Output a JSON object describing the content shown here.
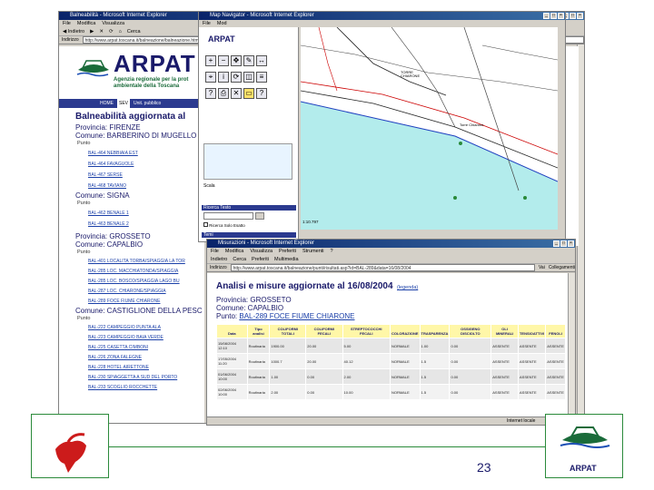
{
  "slide": {
    "page_number": "23",
    "logo_text": "ARPAT"
  },
  "ie_main": {
    "title": "Balneabilità - Microsoft Internet Explorer",
    "address_label": "Indirizzo",
    "address": "http://www.arpat.toscana.it/balneazione/balneazione.htm",
    "brand": "ARPAT",
    "agency_line1": "Agenzia regionale per la prot",
    "agency_line2": "ambientale della Toscana",
    "nav_home": "HOME",
    "nav_sev": "SEV",
    "nav_public": "Unit. pubblico",
    "heading": "Balneabilità aggiornata al",
    "prov1": "Provincia: FIRENZE",
    "com1": "Comune: BARBERINO DI MUGELLO",
    "punto_label": "Punto",
    "list1": [
      "BAL-464 NEBBIAIA EST",
      "BAL-464 FAVAGUOLE",
      "BAL-467 SERSE",
      "BAL-468 TAVIANO"
    ],
    "com2": "Comune: SIGNA",
    "list2": [
      "BAL-462 BENALE 1",
      "BAL-463 BENALE 2"
    ],
    "prov2": "Provincia: GROSSETO",
    "com3": "Comune: CAPALBIO",
    "list3": [
      "BAL-401 LOCALITA TORBA/SPIAGGIA LA TOR",
      "BAL-285 LOC. MACCHIATONDA/SPIAGGIA",
      "BAL-285 LOC. BOSCO/SPIAGGIA LAGO BU",
      "BAL-287 LOC. CHIARONE/SPIAGGIA",
      "BAL-289 FOCE FIUME CHIARONE"
    ],
    "com4": "Comune: CASTIGLIONE DELLA PESC",
    "list4": [
      "BAL-222 CAMPEGGIO PUNTA ALA",
      "BAL-223 CAMPEGGIO BAIA VERDE",
      "BAL-225 CASETTA CIMBONI",
      "BAL-226 ZONA FALEGNE",
      "BAL-228 HOTEL AIRETTONE",
      "BAL-230 SPIAGGETTA A SUD DEL PORTO",
      "BAL-233 SCOGLIO ROCCHETTE"
    ]
  },
  "map_win": {
    "title": "Map Navigator - Microsoft Internet Explorer",
    "brand": "ARPAT",
    "scale_label": "Scala",
    "search_label": "Ricerca Testo",
    "checkbox_label": "Ricerca Solo Esatto",
    "layers_label": "Temi",
    "scale_value": "1:10.797",
    "map_labels": [
      "TORRE CHIARONE",
      "Torre Chiarone"
    ]
  },
  "results_win": {
    "title": "Misurazioni - Microsoft Internet Explorer",
    "menu": [
      "File",
      "Modifica",
      "Visualizza",
      "Preferiti",
      "Strumenti",
      "?"
    ],
    "toolbar": [
      "Indietro",
      "Cerca",
      "Preferiti",
      "Multimedia"
    ],
    "address_label": "Indirizzo",
    "address": "http://www.arpat.toscana.it/balneazione/punti/risultati.asp?id=BAL-289&data=16/08/2004",
    "go_label": "Vai",
    "links_label": "Collegamenti",
    "heading": "Analisi e misure aggiornate al 16/08/2004",
    "legend_link": "(legenda)",
    "province": "Provincia: GROSSETO",
    "comune": "Comune: CAPALBIO",
    "punto_prefix": "Punto: ",
    "punto": "BAL-289 FOCE FIUME CHIARONE",
    "status": "Internet locale",
    "columns": [
      "Data",
      "Tipo analisi",
      "COLIFORMI TOTALI",
      "COLIFORMI FECALI",
      "STREPTOCOCCHI FECALI",
      "COLORAZIONE",
      "TRASPARENZA",
      "OSSIGENO DISCIOLTO",
      "OLI MINERALI",
      "TENSIOATTIVI",
      "FENOLI"
    ],
    "rows": [
      [
        "15/08/2004 12:10",
        "Routinaria",
        "1900.00",
        "20.00",
        "5.00",
        "NORMALE",
        "1.00",
        "0.00",
        "ASSENTE",
        "ASSENTE",
        "ASSENTE"
      ],
      [
        "17/05/2004 11:20",
        "Routinaria",
        "1000.7",
        "20.00",
        "40.12",
        "NORMALE",
        "1.5",
        "0.00",
        "ASSENTE",
        "ASSENTE",
        "ASSENTE"
      ],
      [
        "01/06/2004 10:00",
        "Routinaria",
        "1.00",
        "0.00",
        "2.00",
        "NORMALE",
        "1.5",
        "0.00",
        "ASSENTE",
        "ASSENTE",
        "ASSENTE"
      ],
      [
        "02/06/2004 10:00",
        "Routinaria",
        "2.00",
        "0.00",
        "10.00",
        "NORMALE",
        "1.5",
        "0.00",
        "ASSENTE",
        "ASSENTE",
        "ASSENTE"
      ]
    ]
  }
}
